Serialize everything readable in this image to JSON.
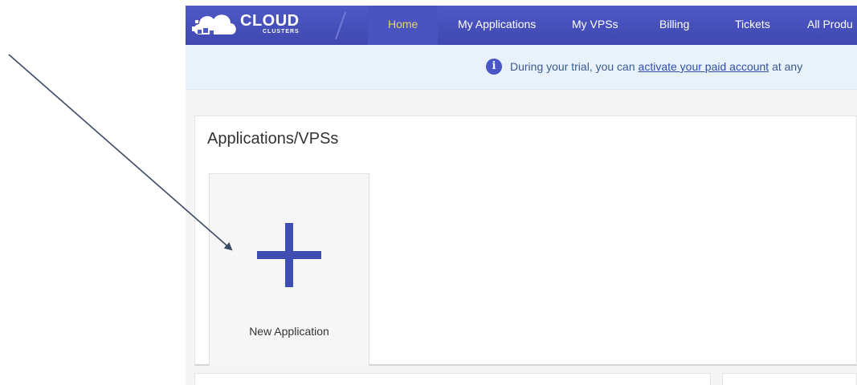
{
  "brand": {
    "name": "CLOUD",
    "sub": "CLUSTERS",
    "color": "#434db8",
    "accent_active": "#e6d36b"
  },
  "nav": {
    "items": [
      {
        "label": "Home",
        "active": true
      },
      {
        "label": "My Applications",
        "active": false
      },
      {
        "label": "My VPSs",
        "active": false
      },
      {
        "label": "Billing",
        "active": false
      },
      {
        "label": "Tickets",
        "active": false
      },
      {
        "label": "All Produ",
        "active": false
      }
    ]
  },
  "notice": {
    "icon": "info-icon",
    "prefix": "During your trial, you can ",
    "link": "activate your paid account",
    "suffix": " at any"
  },
  "panel": {
    "title": "Applications/VPSs",
    "new_app": {
      "icon": "plus-icon",
      "label": "New Application"
    }
  }
}
